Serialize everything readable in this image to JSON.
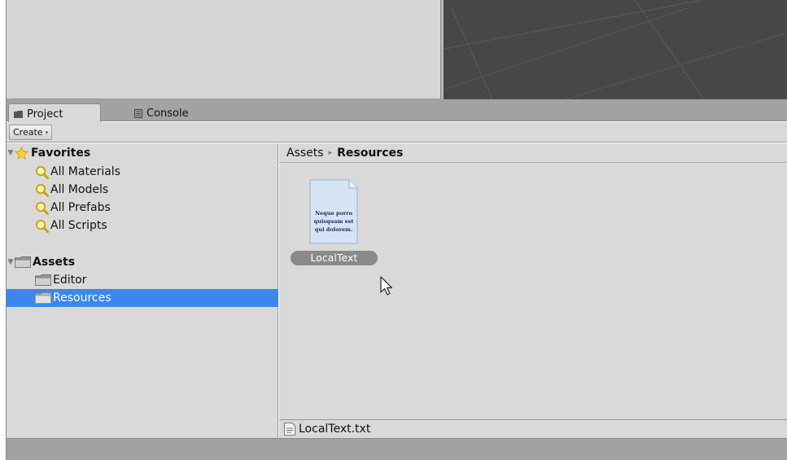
{
  "tabs": [
    {
      "label": "Project",
      "icon": "folder-icon",
      "active": true
    },
    {
      "label": "Console",
      "icon": "console-icon",
      "active": false
    }
  ],
  "toolbar": {
    "create_label": "Create",
    "create_caret": "▾"
  },
  "tree": {
    "favorites": {
      "label": "Favorites",
      "icon": "star-icon",
      "items": [
        {
          "label": "All Materials"
        },
        {
          "label": "All Models"
        },
        {
          "label": "All Prefabs"
        },
        {
          "label": "All Scripts"
        }
      ]
    },
    "assets": {
      "label": "Assets",
      "icon": "folder-icon",
      "items": [
        {
          "label": "Editor",
          "selected": false
        },
        {
          "label": "Resources",
          "selected": true
        }
      ]
    }
  },
  "breadcrumb": {
    "root": "Assets",
    "separator": "▸",
    "current": "Resources"
  },
  "asset": {
    "name": "LocalText",
    "preview_lines": [
      "Neque porro",
      "quisquam est",
      "qui dolorem."
    ]
  },
  "status": {
    "file_name": "LocalText.txt"
  },
  "colors": {
    "selection": "#3d86f2",
    "panel_bg": "#d9d9d9",
    "scene_bg": "#474747",
    "label_pill": "#8a8a8a"
  }
}
